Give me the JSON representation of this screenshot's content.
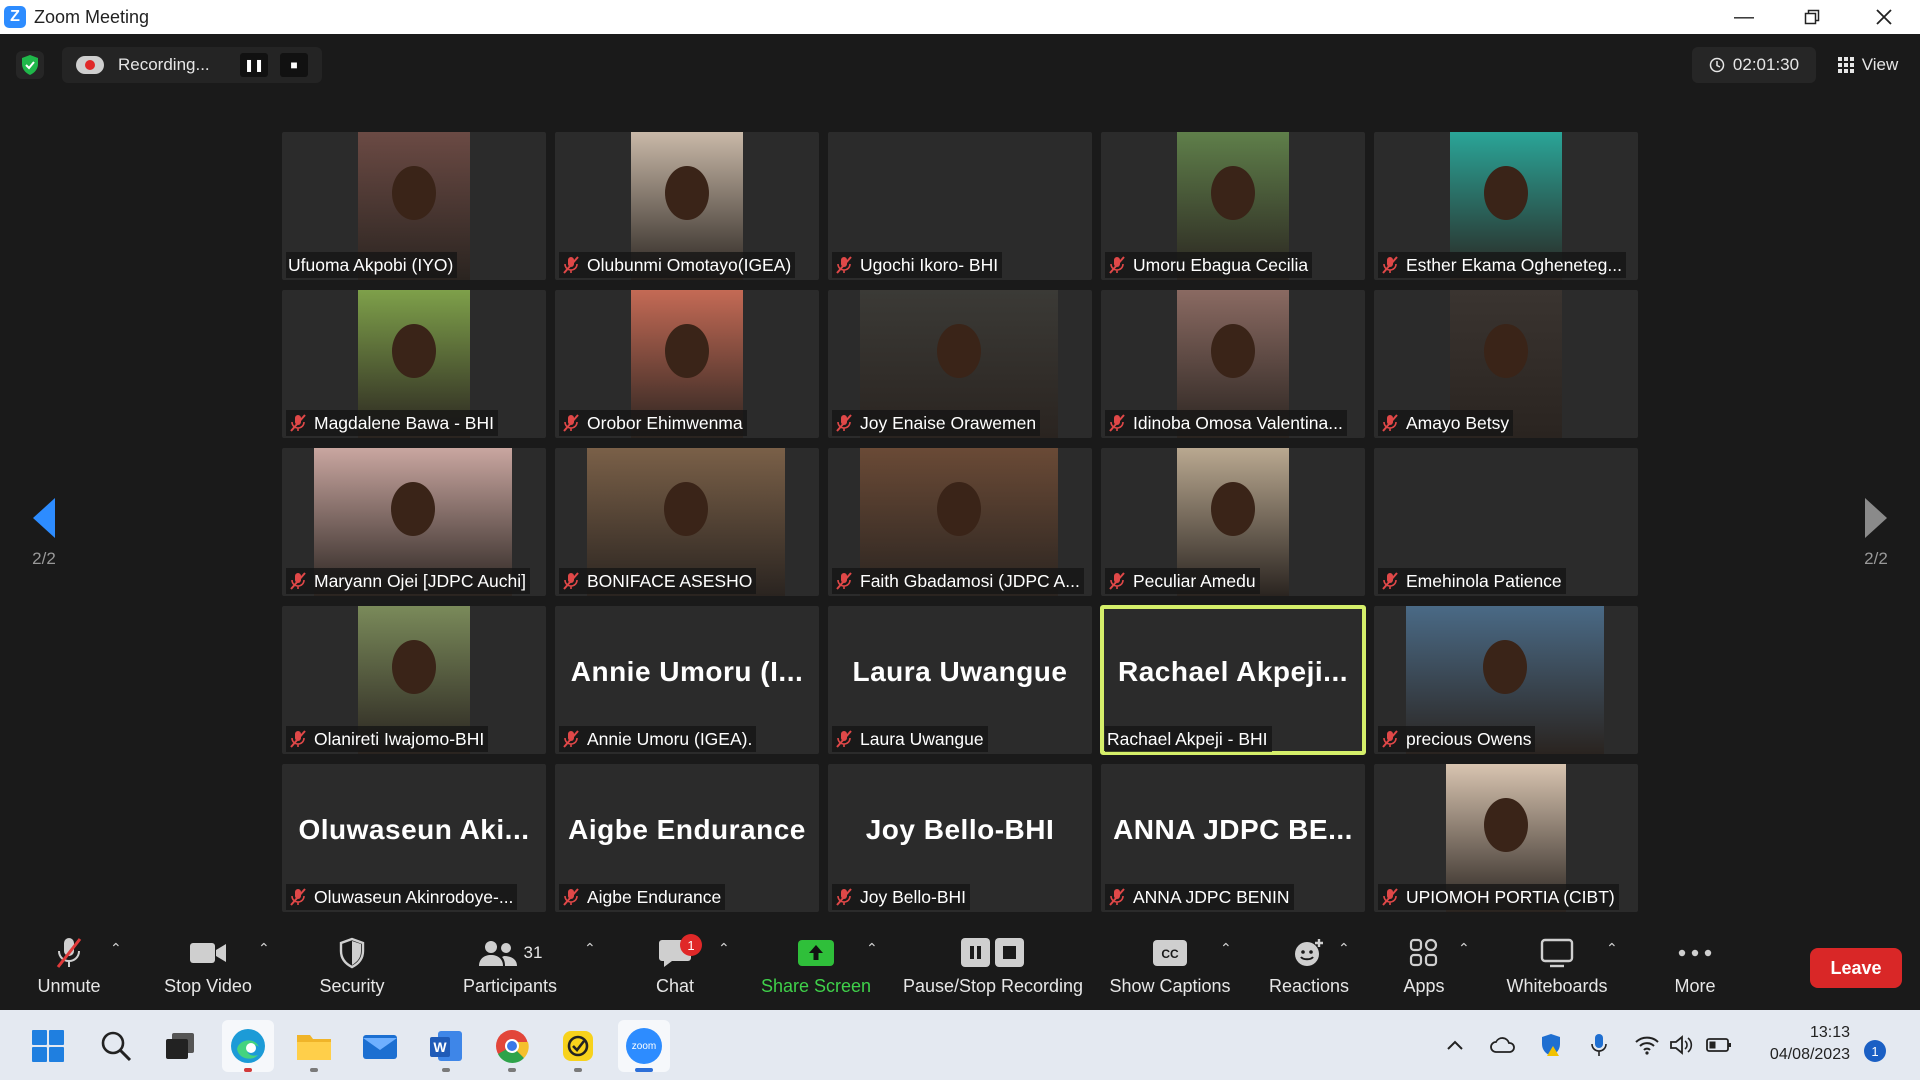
{
  "window": {
    "title": "Zoom Meeting"
  },
  "recording": {
    "status": "Recording..."
  },
  "timer": {
    "value": "02:01:30"
  },
  "view": {
    "label": "View"
  },
  "pager": {
    "left": "2/2",
    "right": "2/2"
  },
  "participants": [
    {
      "label": "Ufuoma Akpobi (IYO)",
      "big": "",
      "muted": false,
      "video": "#6b4a44"
    },
    {
      "label": "Olubunmi  Omotayo(IGEA)",
      "big": "",
      "muted": true,
      "video": "#c9b9a8"
    },
    {
      "label": "Ugochi Ikoro- BHI",
      "big": "",
      "muted": true,
      "video": ""
    },
    {
      "label": "Umoru Ebagua Cecilia",
      "big": "",
      "muted": true,
      "video": "#5f7f4a"
    },
    {
      "label": "Esther Ekama Ogheneteg...",
      "big": "",
      "muted": true,
      "video": "#2aa598"
    },
    {
      "label": "Magdalene Bawa - BHI",
      "big": "",
      "muted": true,
      "video": "#7ea04a"
    },
    {
      "label": "Orobor Ehimwenma",
      "big": "",
      "muted": true,
      "video": "#c46a55"
    },
    {
      "label": "Joy Enaise Orawemen",
      "big": "",
      "muted": true,
      "video": "#3b3a36"
    },
    {
      "label": "Idinoba Omosa Valentina...",
      "big": "",
      "muted": true,
      "video": "#8a6a62"
    },
    {
      "label": "Amayo Betsy",
      "big": "",
      "muted": true,
      "video": "#3a3430"
    },
    {
      "label": "Maryann Ojei [JDPC Auchi]",
      "big": "",
      "muted": true,
      "video": "#c9a6a0"
    },
    {
      "label": "BONIFACE ASESHO",
      "big": "",
      "muted": true,
      "video": "#7a6048"
    },
    {
      "label": "Faith Gbadamosi (JDPC A...",
      "big": "",
      "muted": true,
      "video": "#6a4a36"
    },
    {
      "label": "Peculiar Amedu",
      "big": "",
      "muted": true,
      "video": "#b9a890"
    },
    {
      "label": "Emehinola Patience",
      "big": "",
      "muted": true,
      "video": ""
    },
    {
      "label": "Olanireti Iwajomo-BHI",
      "big": "",
      "muted": true,
      "video": "#7a8a5a"
    },
    {
      "label": "Annie Umoru (IGEA).",
      "big": "Annie  Umoru  (I...",
      "muted": true,
      "video": ""
    },
    {
      "label": "Laura Uwangue",
      "big": "Laura Uwangue",
      "muted": true,
      "video": ""
    },
    {
      "label": "Rachael Akpeji - BHI",
      "big": "Rachael  Akpeji...",
      "muted": false,
      "video": ""
    },
    {
      "label": "precious Owens",
      "big": "",
      "muted": true,
      "video": "#4a6a86"
    },
    {
      "label": "Oluwaseun  Akinrodoye-...",
      "big": "Oluwaseun   Aki...",
      "muted": true,
      "video": ""
    },
    {
      "label": "Aigbe Endurance",
      "big": "Aigbe Endurance",
      "muted": true,
      "video": ""
    },
    {
      "label": "Joy Bello-BHI",
      "big": "Joy Bello-BHI",
      "muted": true,
      "video": ""
    },
    {
      "label": "ANNA JDPC BENIN",
      "big": "ANNA  JDPC  BE...",
      "muted": true,
      "video": ""
    },
    {
      "label": "UPIOMOH PORTIA (CIBT)",
      "big": "",
      "muted": true,
      "video": "#d8c4b0"
    }
  ],
  "toolbar": {
    "unmute": "Unmute",
    "stop_video": "Stop Video",
    "security": "Security",
    "participants": "Participants",
    "participants_count": "31",
    "chat": "Chat",
    "chat_badge": "1",
    "share_screen": "Share Screen",
    "pause_stop_recording": "Pause/Stop Recording",
    "show_captions": "Show Captions",
    "reactions": "Reactions",
    "apps": "Apps",
    "whiteboards": "Whiteboards",
    "more": "More",
    "leave": "Leave"
  },
  "taskbar": {
    "apps": [
      "start-icon",
      "search-icon",
      "task-view-icon",
      "edge-icon",
      "file-explorer-icon",
      "mail-icon",
      "word-icon",
      "chrome-icon",
      "norton-icon",
      "zoom-icon"
    ],
    "zoom_label": "zoom",
    "time": "13:13",
    "date": "04/08/2023",
    "notifications": "1"
  },
  "colors": {
    "accent_active_speaker": "#d5ef6a",
    "leave": "#d92727",
    "share_green": "#3fd14a",
    "zoom_blue": "#2d8cff"
  }
}
